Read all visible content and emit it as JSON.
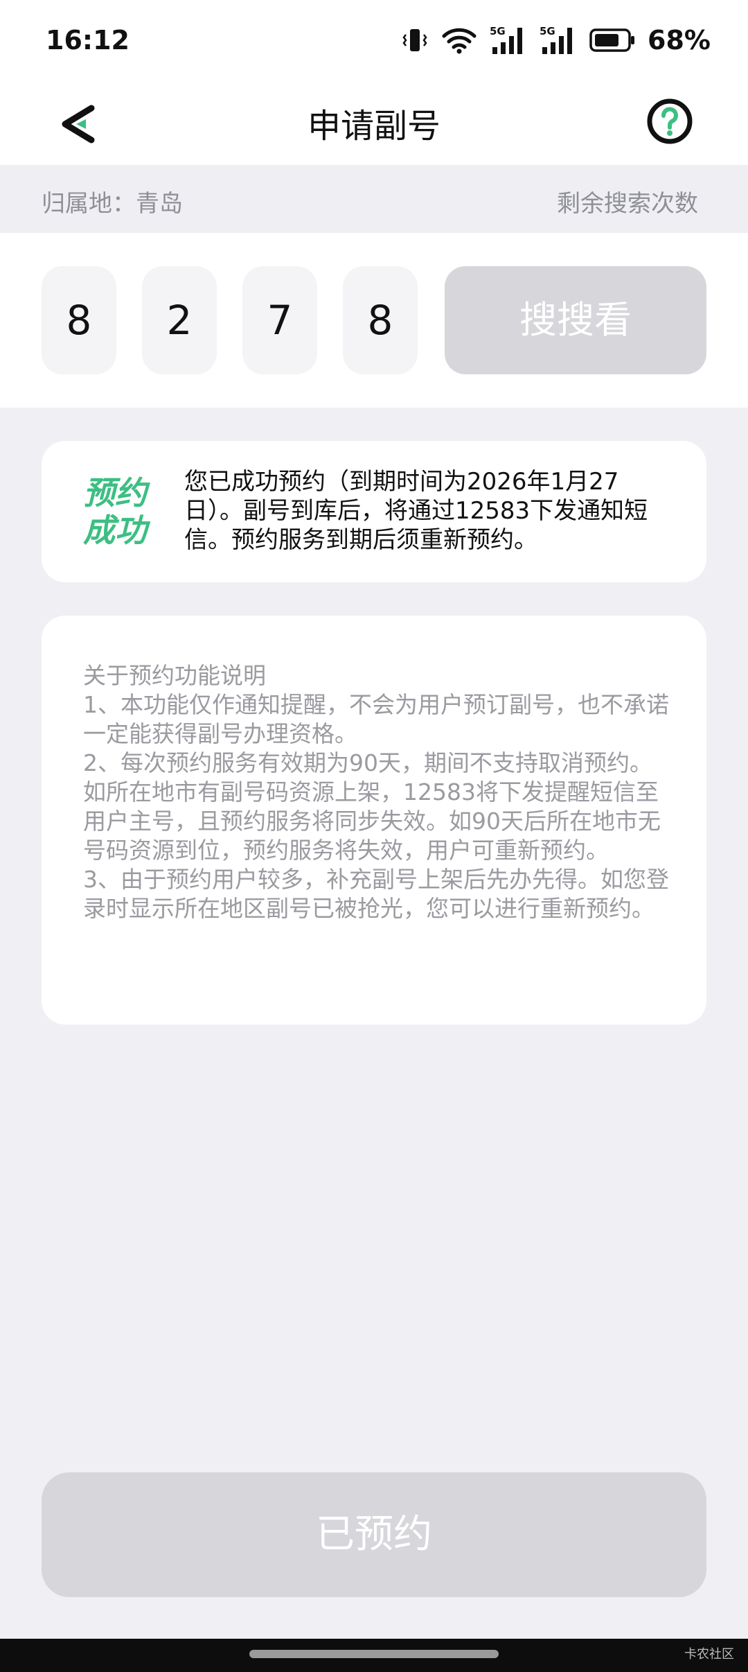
{
  "status_bar": {
    "time": "16:12",
    "battery": "68%",
    "icons": [
      "vibrate-icon",
      "wifi-icon",
      "5g-signal-icon",
      "5g-signal-icon",
      "battery-icon"
    ]
  },
  "nav": {
    "back_icon": "back-arrow-icon",
    "title": "申请副号",
    "help_icon": "help-icon",
    "accent_color": "#3cbf82"
  },
  "location_bar": {
    "location": "归属地：青岛",
    "remaining": "剩余搜索次数"
  },
  "search": {
    "digits": [
      "8",
      "2",
      "7",
      "8"
    ],
    "button_label": "搜搜看"
  },
  "success_card": {
    "badge_line1": "预约",
    "badge_line2": "成功",
    "message": "您已成功预约（到期时间为2026年1月27日）。副号到库后，将通过12583下发通知短信。预约服务到期后须重新预约。"
  },
  "info_card": {
    "title": "关于预约功能说明",
    "items": [
      "1、本功能仅作通知提醒，不会为用户预订副号，也不承诺一定能获得副号办理资格。",
      "2、每次预约服务有效期为90天，期间不支持取消预约。如所在地市有副号码资源上架，12583将下发提醒短信至用户主号，且预约服务将同步失效。如90天后所在地市无号码资源到位，预约服务将失效，用户可重新预约。",
      "3、由于预约用户较多，补充副号上架后先办先得。如您登录时显示所在地区副号已被抢光，您可以进行重新预约。"
    ]
  },
  "bottom_button": {
    "label": "已预约"
  },
  "footer": {
    "watermark": "卡农社区"
  }
}
